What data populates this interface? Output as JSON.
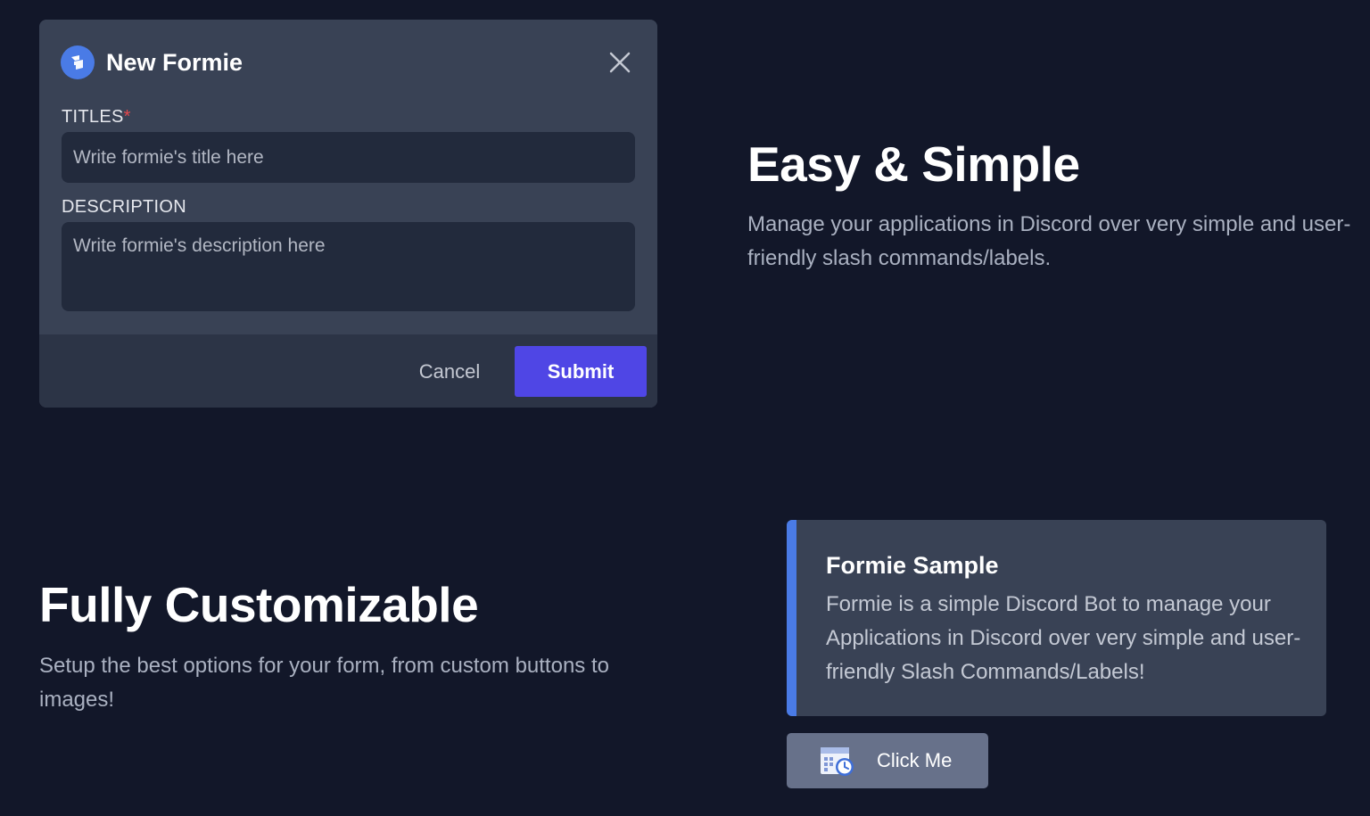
{
  "modal": {
    "title": "New Formie",
    "logo_icon": "formie-logo-icon",
    "close_icon": "close-icon",
    "titles_label": "TITLES",
    "required_mark": "*",
    "title_placeholder": "Write formie's title here",
    "description_label": "DESCRIPTION",
    "description_placeholder": "Write formie's description here",
    "cancel_label": "Cancel",
    "submit_label": "Submit",
    "colors": {
      "accent": "#4f46e5",
      "logo": "#4a7be6",
      "required": "#e5484d"
    }
  },
  "easy": {
    "heading": "Easy & Simple",
    "text": "Manage your applications in Discord over very simple and user-friendly slash commands/labels."
  },
  "custom": {
    "heading": "Fully Customizable",
    "text": "Setup the best options for your form, from custom buttons to images!"
  },
  "embed": {
    "title": "Formie Sample",
    "description": "Formie is a simple Discord Bot to manage your Applications in Discord over very simple and user-friendly Slash Commands/Labels!",
    "bar_color": "#4a7be6"
  },
  "click_button": {
    "label": "Click Me",
    "icon": "calendar-clock-icon"
  }
}
